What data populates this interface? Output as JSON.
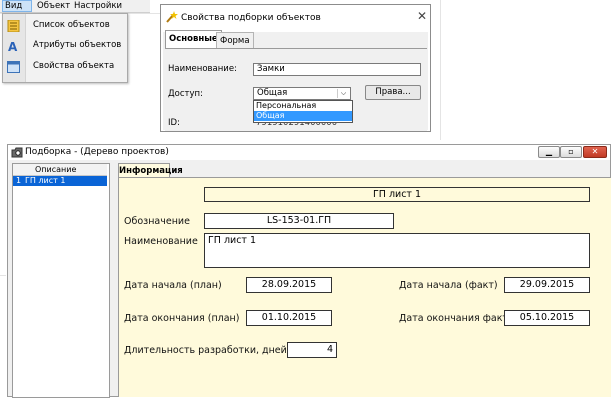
{
  "menu": {
    "items": [
      "Вид",
      "Объект",
      "Настройки"
    ],
    "dropdown": [
      {
        "icon": "list-icon",
        "label": "Список объектов"
      },
      {
        "icon": "attributes-icon",
        "label": "Атрибуты объектов"
      },
      {
        "icon": "properties-icon",
        "label": "Свойства объекта"
      }
    ]
  },
  "dialog": {
    "title": "Свойства подборки объектов",
    "tabs": [
      "Основные",
      "Форма"
    ],
    "name_label": "Наименование:",
    "name_value": "Замки",
    "access_label": "Доступ:",
    "access_value": "Общая",
    "access_options": [
      "Персональная",
      "Общая"
    ],
    "rights_button": "Права...",
    "id_label": "ID:",
    "id_value": "791910291400000"
  },
  "window": {
    "title": "Подборка -  (Дерево проектов)",
    "left_column_header": "Описание",
    "left_rows": [
      {
        "num": "1",
        "label": "ГП лист 1"
      }
    ],
    "tab": "Информация",
    "header_value": "ГП лист 1",
    "designation_label": "Обозначение",
    "designation_value": "LS-153-01.ГП",
    "name_label": "Наименование",
    "name_value": "ГП лист 1",
    "start_plan_label": "Дата начала (план)",
    "start_plan_value": "28.09.2015",
    "start_fact_label": "Дата начала (факт)",
    "start_fact_value": "29.09.2015",
    "end_plan_label": "Дата окончания (план)",
    "end_plan_value": "01.10.2015",
    "end_fact_label": "Дата окончания факт",
    "end_fact_value": "05.10.2015",
    "duration_label": "Длительность разработки, дней",
    "duration_value": "4"
  },
  "colors": {
    "panel_bg": "#fffadb",
    "selection": "#0a64d6",
    "close_button": "#c13a25"
  }
}
